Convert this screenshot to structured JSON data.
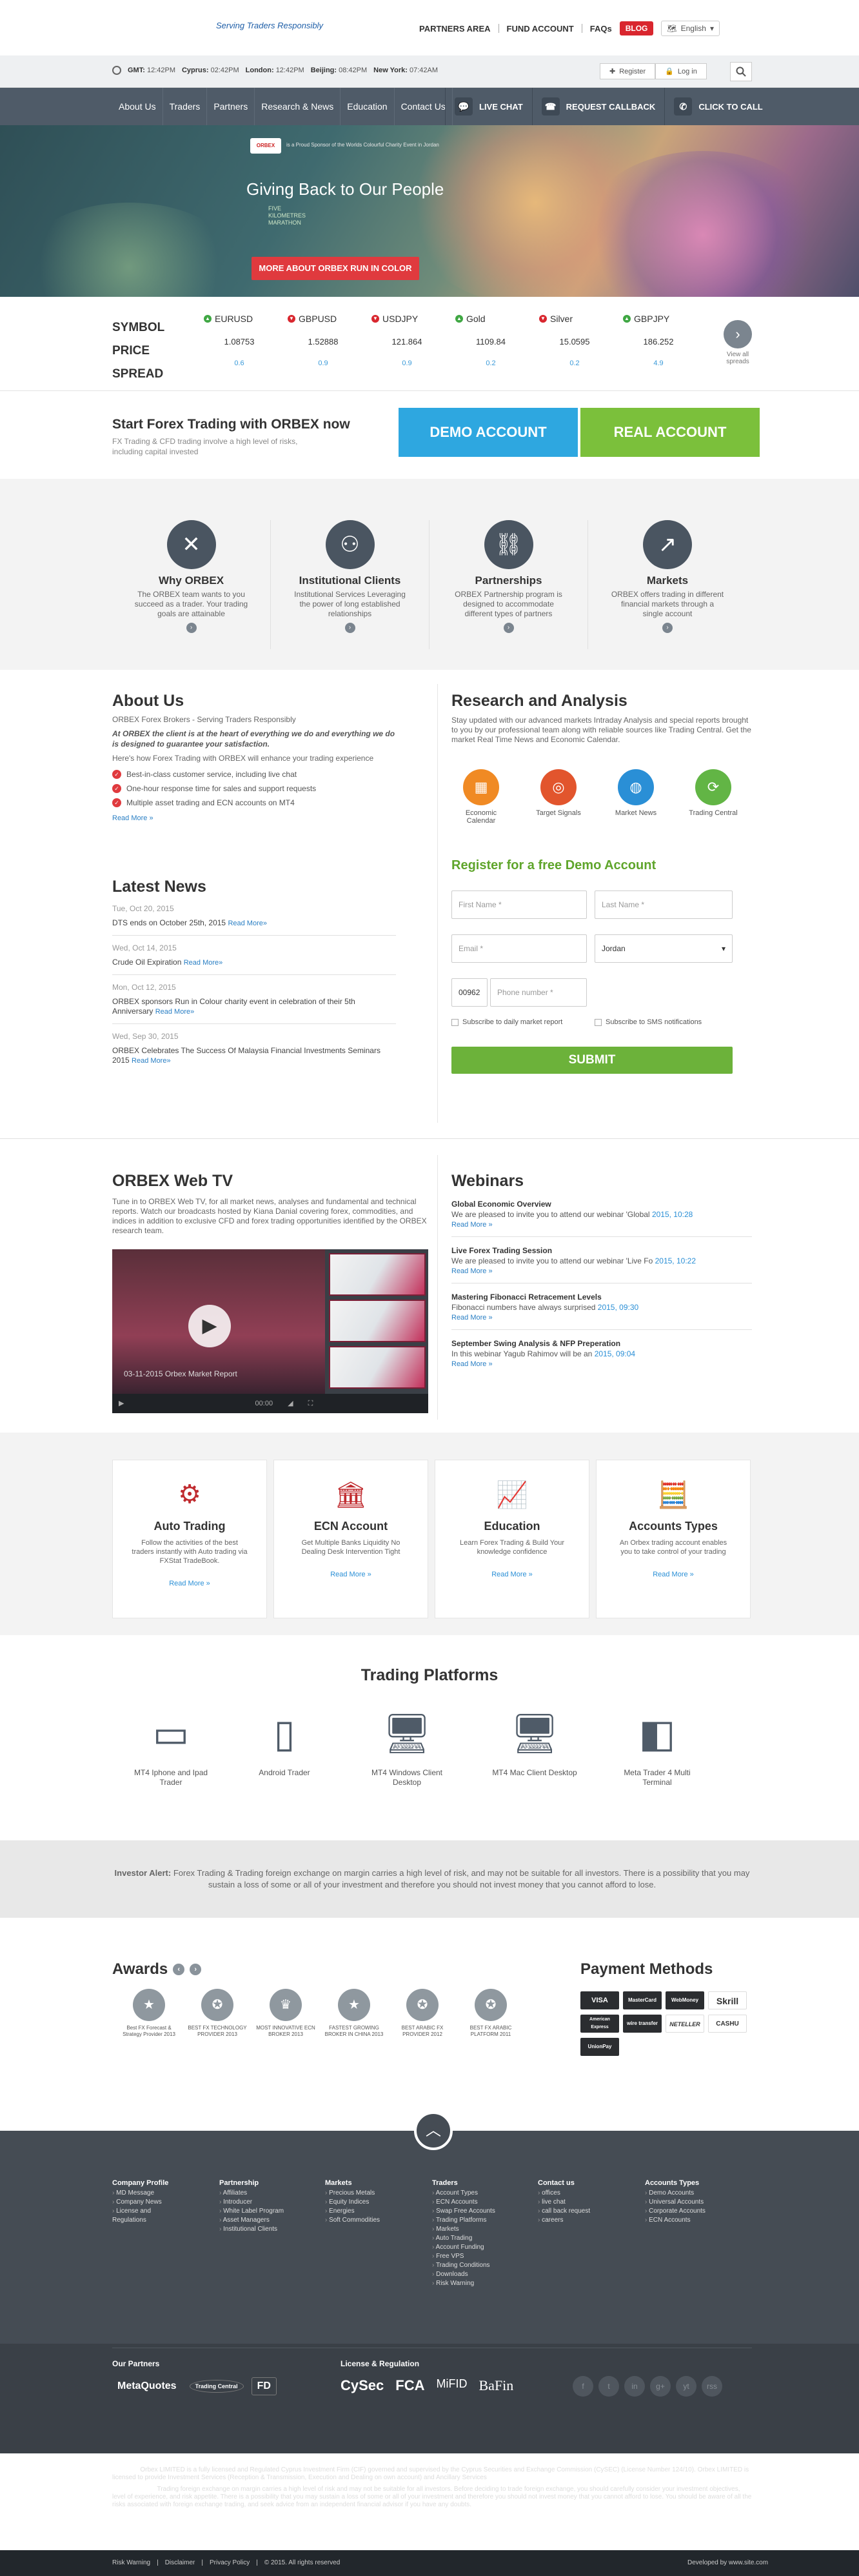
{
  "header": {
    "tagline": "Serving Traders Responsibly",
    "nav": [
      "PARTNERS AREA",
      "FUND ACCOUNT",
      "FAQs"
    ],
    "blog": "BLOG",
    "language": "English",
    "clocks": [
      {
        "city": "GMT:",
        "time": "12:42PM"
      },
      {
        "city": "Cyprus:",
        "time": "02:42PM"
      },
      {
        "city": "London:",
        "time": "12:42PM"
      },
      {
        "city": "Beijing:",
        "time": "08:42PM"
      },
      {
        "city": "New York:",
        "time": "07:42AM"
      }
    ],
    "register": "Register",
    "login": "Log in"
  },
  "menu": [
    "About Us",
    "Traders",
    "Partners",
    "Research & News",
    "Education",
    "Contact Us"
  ],
  "ctas": {
    "chat": "LIVE CHAT",
    "callback": "REQUEST CALLBACK",
    "call": "CLICK TO CALL"
  },
  "hero": {
    "logo": "ORBEX",
    "small": "is a Proud Sponsor of the Worlds Colourful Charity Event in Jordan",
    "title": "Giving Back to Our People",
    "line1": "FIVE",
    "line2": "KILOMETRES",
    "line3": "MARATHON",
    "button": "MORE ABOUT ORBEX RUN IN COLOR"
  },
  "ticker": {
    "labels": [
      "SYMBOL",
      "PRICE",
      "SPREAD"
    ],
    "items": [
      {
        "symbol": "EURUSD",
        "price": "1.08753",
        "spread": "0.6",
        "dir": "up"
      },
      {
        "symbol": "GBPUSD",
        "price": "1.52888",
        "spread": "0.9",
        "dir": "down"
      },
      {
        "symbol": "USDJPY",
        "price": "121.864",
        "spread": "0.9",
        "dir": "down"
      },
      {
        "symbol": "Gold",
        "price": "1109.84",
        "spread": "0.2",
        "dir": "up"
      },
      {
        "symbol": "Silver",
        "price": "15.0595",
        "spread": "0.2",
        "dir": "down"
      },
      {
        "symbol": "GBPJPY",
        "price": "186.252",
        "spread": "4.9",
        "dir": "up"
      }
    ],
    "viewall": "View all spreads"
  },
  "cta": {
    "title": "Start Forex Trading with ORBEX now",
    "sub": "FX Trading & CFD trading involve a high level of risks, including capital invested",
    "demo": "DEMO ACCOUNT",
    "real": "REAL ACCOUNT"
  },
  "features": [
    {
      "title": "Why ORBEX",
      "desc": "The ORBEX team wants to you succeed as a trader. Your trading goals are attainable"
    },
    {
      "title": "Institutional Clients",
      "desc": "Institutional Services Leveraging the power of long established relationships"
    },
    {
      "title": "Partnerships",
      "desc": "ORBEX Partnership program is designed to accommodate different types of partners"
    },
    {
      "title": "Markets",
      "desc": "ORBEX offers trading in different financial markets through a single account"
    }
  ],
  "about": {
    "title": "About Us",
    "intro": "ORBEX Forex Brokers - Serving Traders Responsibly",
    "italic": "At ORBEX the client is at the heart of everything we do and everything we do is designed to guarantee your satisfaction.",
    "howto": "Here's how Forex Trading with ORBEX will enhance your trading experience",
    "bullets": [
      "Best-in-class customer service, including live chat",
      "One-hour response time for sales and support requests",
      "Multiple asset trading and ECN accounts on MT4"
    ],
    "more": "Read More »"
  },
  "news": {
    "title": "Latest News",
    "items": [
      {
        "date": "Tue, Oct 20, 2015",
        "text": "DTS ends on October 25th, 2015",
        "more": "Read More»"
      },
      {
        "date": "Wed, Oct 14, 2015",
        "text": "Crude Oil Expiration",
        "more": "Read More»"
      },
      {
        "date": "Mon, Oct 12, 2015",
        "text": "ORBEX sponsors Run in Colour charity event in celebration of their 5th Anniversary",
        "more": "Read More»"
      },
      {
        "date": "Wed, Sep 30, 2015",
        "text": "ORBEX Celebrates The Success Of Malaysia Financial Investments Seminars 2015",
        "more": "Read More»"
      }
    ]
  },
  "research": {
    "title": "Research and Analysis",
    "desc": "Stay updated with our advanced markets Intraday Analysis and special reports brought to you by our professional team along with reliable sources like Trading Central. Get the market Real Time News and Economic Calendar.",
    "icons": [
      {
        "label": "Economic Calendar",
        "color": "#f08a24",
        "icon": "calendar-icon"
      },
      {
        "label": "Target Signals",
        "color": "#e2552d",
        "icon": "target-icon"
      },
      {
        "label": "Market News",
        "color": "#2a8fd6",
        "icon": "globe-icon"
      },
      {
        "label": "Trading Central",
        "color": "#62b545",
        "icon": "trading-central-icon"
      }
    ]
  },
  "register": {
    "title": "Register for a free Demo Account",
    "first": "First Name *",
    "last": "Last Name *",
    "email": "Email *",
    "country": "Jordan",
    "code": "00962",
    "phone": "Phone number *",
    "sub1": "Subscribe to daily market report",
    "sub2": "Subscribe to SMS notifications",
    "submit": "SUBMIT"
  },
  "webtv": {
    "title": "ORBEX Web TV",
    "desc": "Tune in to ORBEX Web TV, for all market news, analyses and fundamental and technical reports. Watch our broadcasts hosted by Kiana Danial covering forex, commodities, and indices in addition to exclusive CFD and forex trading opportunities identified by the ORBEX research team.",
    "caption": "03-11-2015 Orbex Market Report",
    "time": "00:00"
  },
  "webinars": {
    "title": "Webinars",
    "items": [
      {
        "title": "Global Economic Overview",
        "desc": "We are pleased to invite you to attend our webinar 'Global",
        "date": "2015, 10:28",
        "more": "Read More »"
      },
      {
        "title": "Live Forex Trading Session",
        "desc": "We are pleased to invite you to attend our webinar 'Live Fo",
        "date": "2015, 10:22",
        "more": "Read More »"
      },
      {
        "title": "Mastering Fibonacci Retracement Levels",
        "desc": "Fibonacci numbers have always surprised",
        "date": "2015, 09:30",
        "more": "Read More »"
      },
      {
        "title": "September Swing Analysis & NFP Preperation",
        "desc": "In this webinar Yagub Rahimov will be an",
        "date": "2015, 09:04",
        "more": "Read More »"
      }
    ]
  },
  "services": [
    {
      "title": "Auto Trading",
      "desc": "Follow the activities of the best traders instantly with Auto trading via FXStat TradeBook.",
      "more": "Read More »"
    },
    {
      "title": "ECN Account",
      "desc": "Get Multiple Banks Liquidity No Dealing Desk Intervention Tight",
      "more": "Read More »"
    },
    {
      "title": "Education",
      "desc": "Learn Forex Trading & Build Your knowledge confidence",
      "more": "Read More »"
    },
    {
      "title": "Accounts Types",
      "desc": "An Orbex trading account enables you to take control of your trading",
      "more": "Read More »"
    }
  ],
  "platforms": {
    "title": "Trading Platforms",
    "items": [
      "MT4 Iphone and Ipad Trader",
      "Android Trader",
      "MT4 Windows Client Desktop",
      "MT4 Mac Client Desktop",
      "Meta Trader 4 Multi Terminal"
    ]
  },
  "alert": {
    "label": "Investor Alert:",
    "text": "Forex Trading & Trading foreign exchange on margin carries a high level of risk, and may not be suitable for all investors. There is a possibility that you may sustain a loss of some or all of your investment and therefore you should not invest money that you cannot afford to lose."
  },
  "awards": {
    "title": "Awards",
    "items": [
      "Best FX Forecast & Strategy Provider 2013",
      "BEST FX TECHNOLOGY PROVIDER 2013",
      "MOST INNOVATIVE ECN BROKER 2013",
      "FASTEST GROWING BROKER IN CHINA 2013",
      "BEST ARABIC FX PROVIDER 2012",
      "BEST FX ARABIC PLATFORM 2011"
    ]
  },
  "payment": {
    "title": "Payment Methods",
    "items": [
      "VISA",
      "MasterCard",
      "WebMoney",
      "Skrill",
      "American Express",
      "wire transfer",
      "NETELLER",
      "CASHU",
      "UnionPay"
    ]
  },
  "footer": {
    "columns": [
      {
        "title": "Company Profile",
        "links": [
          "MD Message",
          "Company News",
          "License and Regulations"
        ]
      },
      {
        "title": "Partnership",
        "links": [
          "Affiliates",
          "Introducer",
          "White Label Program",
          "Asset Managers",
          "Institutional Clients"
        ]
      },
      {
        "title": "Markets",
        "links": [
          "Precious Metals",
          "Equity Indices",
          "Energies",
          "Soft Commodities"
        ]
      },
      {
        "title": "Traders",
        "links": [
          "Account Types",
          "ECN Accounts",
          "Swap Free Accounts",
          "Trading Platforms",
          "Markets",
          "Auto Trading",
          "Account Funding",
          "Free VPS",
          "Trading Conditions",
          "Downloads",
          "Risk Warning"
        ]
      },
      {
        "title": "Contact us",
        "links": [
          "offices",
          "live chat",
          "call back request",
          "careers"
        ]
      },
      {
        "title": "Accounts Types",
        "links": [
          "Demo Accounts",
          "Universal Accounts",
          "Corporate Accounts",
          "ECN Accounts"
        ]
      }
    ],
    "partners": "Our Partners",
    "partner_logos": [
      "MetaQuotes",
      "Trading Central",
      "FD"
    ],
    "license": "License & Regulation",
    "license_logos": [
      "CySec",
      "FCA",
      "MiFID",
      "BaFin"
    ],
    "social": [
      "f",
      "t",
      "in",
      "g+",
      "yt",
      "rss"
    ],
    "legal1_label": "License:",
    "legal1": "Orbex LIMITED is a fully licensed and Regulated Cyprus Investment Firm (CIF) governed and supervised by the Cyprus Securities and Exchange Commission (CySEC) (License Number 124/10). Orbex LIMITED is licensed to provide Investment Services (Reception & Transmission, Execution and Dealing on own account) and Ancillary Services",
    "legal2_label": "Risk Warning:",
    "legal2": "Trading foreign exchange on margin carries a high level of risk and may not be suitable for all investors. Before deciding to trade foreign exchange, you should carefully consider your investment objectives, level of experience, and risk appetite. There is a possibility that you may sustain a loss of some or all of your investment and therefore you should not invest money that you cannot afford to lose. You should be aware of all the risks associated with foreign exchange trading, and seek advice from an independent financial advisor if you have any doubts.",
    "bottom": [
      "Risk Warning",
      "Disclaimer",
      "Privacy Policy",
      "© 2015. All rights reserved"
    ],
    "dev": "Developed by  www.site.com"
  }
}
